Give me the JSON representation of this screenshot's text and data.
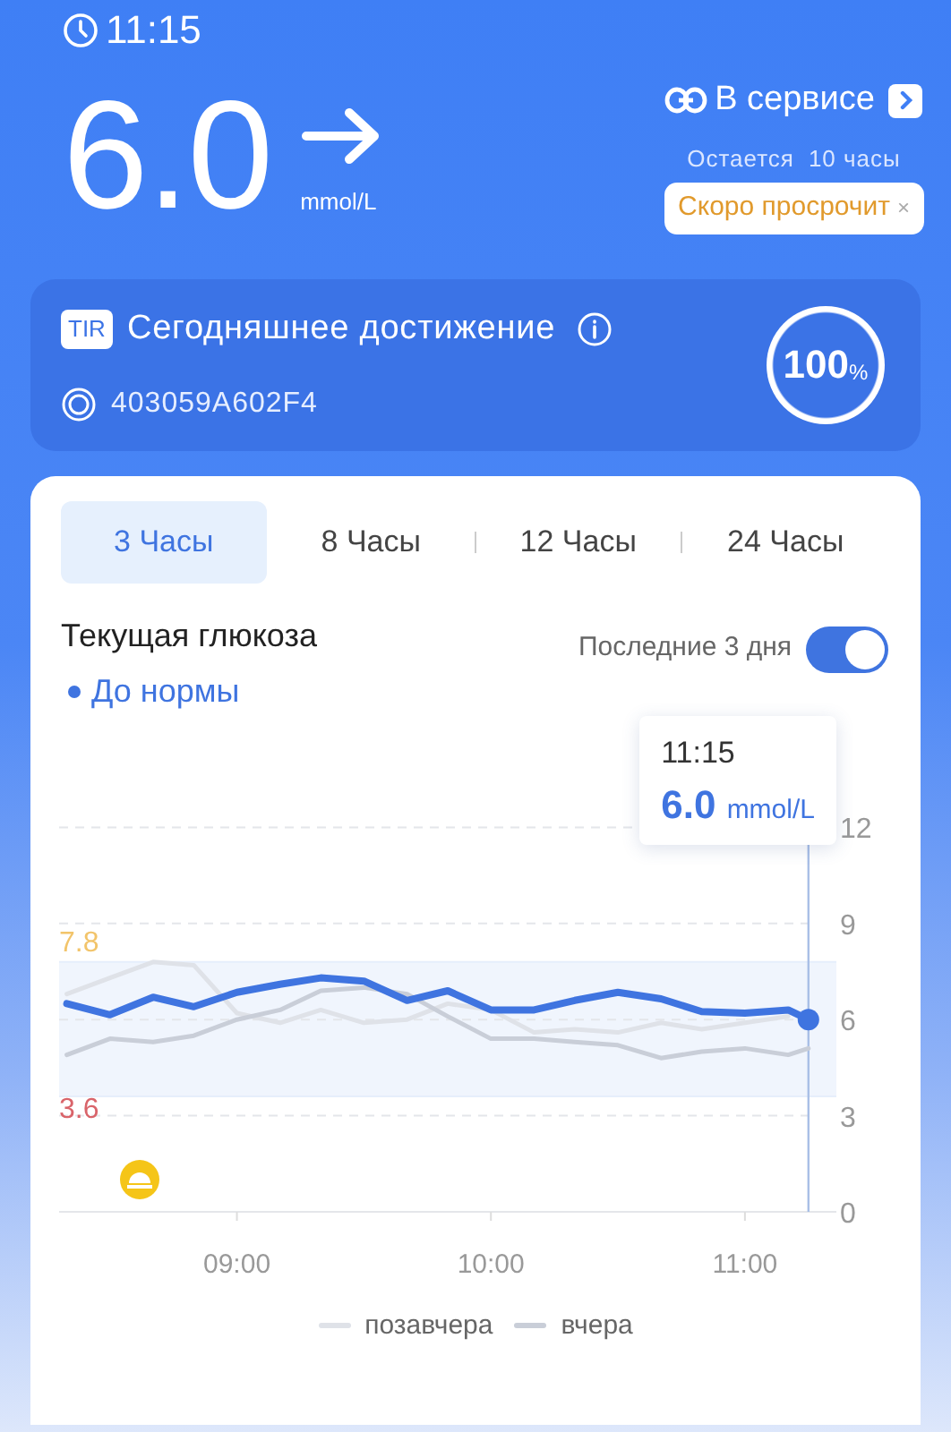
{
  "status_bar": {
    "time": "11:15"
  },
  "reading": {
    "value": "6.0",
    "unit": "mmol/L"
  },
  "sensor": {
    "status": "В сервисе",
    "remaining_label": "Остается",
    "remaining_value": "10 часы",
    "warning": "Скоро просрочит",
    "warning_close": "×"
  },
  "tir": {
    "badge": "TIR",
    "title": "Сегодняшнее достижение",
    "serial": "403059A602F4",
    "percent": "100",
    "percent_unit": "%",
    "level": 1
  },
  "tabs": [
    {
      "label": "3 Часы",
      "selected": true
    },
    {
      "label": "8 Часы",
      "selected": false
    },
    {
      "label": "12 Часы",
      "selected": false
    },
    {
      "label": "24 Часы",
      "selected": false
    }
  ],
  "glucose": {
    "title": "Текущая глюкоза",
    "status": "До нормы",
    "toggle": {
      "label": "Последние 3 дня",
      "on": true
    },
    "tooltip": {
      "time": "11:15",
      "value": "6.0",
      "unit": "mmol/L"
    },
    "chart_data": {
      "type": "line",
      "x": [
        8.33,
        8.5,
        8.67,
        8.83,
        9.0,
        9.17,
        9.33,
        9.5,
        9.67,
        9.83,
        10.0,
        10.17,
        10.33,
        10.5,
        10.67,
        10.83,
        11.0,
        11.17,
        11.25
      ],
      "series": [
        {
          "name": "позавчера",
          "color": "#dfe2e8",
          "values": [
            6.8,
            7.3,
            7.8,
            7.7,
            6.2,
            5.9,
            6.3,
            5.9,
            6.0,
            6.5,
            6.3,
            5.6,
            5.7,
            5.6,
            5.9,
            5.7,
            5.9,
            6.1,
            null
          ]
        },
        {
          "name": "вчера",
          "color": "#c9ced8",
          "values": [
            4.9,
            5.4,
            5.3,
            5.5,
            6.0,
            6.3,
            6.9,
            7.0,
            6.8,
            6.1,
            5.4,
            5.4,
            5.3,
            5.2,
            4.8,
            5.0,
            5.1,
            4.9,
            5.1
          ]
        },
        {
          "color": "#3f74e0",
          "values": [
            6.5,
            6.15,
            6.7,
            6.4,
            6.85,
            7.1,
            7.3,
            7.2,
            6.6,
            6.9,
            6.3,
            6.3,
            6.6,
            6.85,
            6.65,
            6.25,
            6.2,
            6.3,
            6.0
          ]
        }
      ],
      "xlim": [
        8.3,
        11.36
      ],
      "ylim": [
        0,
        12
      ],
      "grid": true,
      "legend": true,
      "xticks": [
        {
          "value": 9,
          "label": "09:00"
        },
        {
          "value": 10,
          "label": "10:00"
        },
        {
          "value": 11,
          "label": "11:00"
        }
      ],
      "yticks": [
        0,
        3,
        6,
        9,
        12
      ],
      "bands": [
        {
          "axis": "y",
          "from": 3.6,
          "to": 7.8
        }
      ],
      "ref_lines": [
        {
          "axis": "y",
          "value": 7.8,
          "label": "7.8"
        },
        {
          "axis": "y",
          "value": 3.6,
          "label": "3.6"
        }
      ]
    }
  }
}
